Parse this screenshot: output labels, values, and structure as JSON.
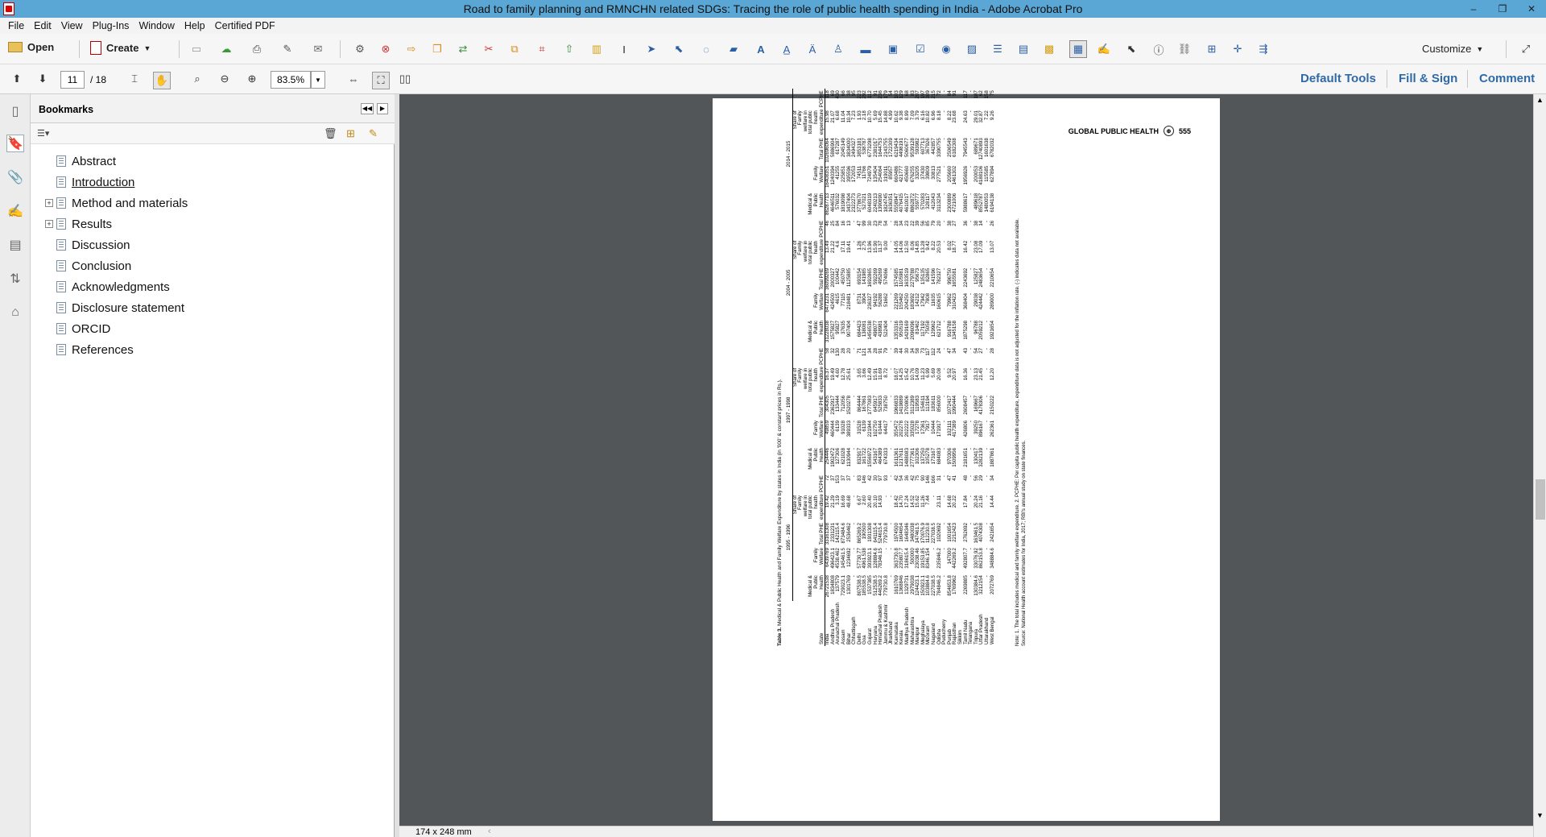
{
  "window": {
    "title": "Road to family planning and RMNCHN related SDGs: Tracing the role of public health spending in India - Adobe Acrobat Pro",
    "minimize": "–",
    "restore": "❐",
    "close": "✕"
  },
  "menu": [
    "File",
    "Edit",
    "View",
    "Plug-Ins",
    "Window",
    "Help",
    "Certified PDF"
  ],
  "toolbar": {
    "open_label": "Open",
    "create_label": "Create",
    "customize_label": "Customize"
  },
  "nav": {
    "current_page": "11",
    "total_pages": "/ 18",
    "zoom": "83.5%"
  },
  "right_panel_links": {
    "default_tools": "Default Tools",
    "fill_sign": "Fill & Sign",
    "comment": "Comment"
  },
  "bookmarks": {
    "title": "Bookmarks",
    "items": [
      {
        "label": "Abstract",
        "expandable": false
      },
      {
        "label": "Introduction",
        "expandable": false
      },
      {
        "label": "Method and materials",
        "expandable": true
      },
      {
        "label": "Results",
        "expandable": true
      },
      {
        "label": "Discussion",
        "expandable": false
      },
      {
        "label": "Conclusion",
        "expandable": false
      },
      {
        "label": "Acknowledgments",
        "expandable": false
      },
      {
        "label": "Disclosure statement",
        "expandable": false
      },
      {
        "label": "ORCID",
        "expandable": false
      },
      {
        "label": "References",
        "expandable": false
      }
    ]
  },
  "status": {
    "page_size": "174 x 248 mm"
  },
  "document": {
    "journal": "GLOBAL PUBLIC HEALTH",
    "page_number": "555",
    "table_caption_bold": "Table 3.",
    "table_caption": "Medical & Public Health and Family Welfare Expenditure by states in India (in '000' & constant prices in Rs.).",
    "periods": [
      "1995 - 1996",
      "1997 - 1998",
      "2004 - 2005",
      "2014 - 2015"
    ],
    "col_state": "State",
    "col_headers": [
      "Medical & Public Health",
      "Family Welfare",
      "Total PHE",
      "Share of Family welfare in total public health expenditure",
      "PCPHE"
    ],
    "rows": [
      [
        "India",
        "26721538",
        "6439769",
        "33161308",
        "19.42",
        "72",
        "254446",
        "49859",
        "304305",
        "16.37",
        "58",
        "31228038",
        "6471231",
        "36099269",
        "13.49",
        "46",
        "86287713",
        "16408351",
        "102696064",
        "15.98",
        "118"
      ],
      [
        "Andhra Pradesh",
        "1834808",
        "496423.1",
        "2331231",
        "21.29",
        "37",
        "1902472",
        "460444",
        "2362917",
        "19.49",
        "32",
        "1575827",
        "424500",
        "2000327",
        "21.22",
        "25",
        "4646511",
        "1240394",
        "5886904",
        "21.07",
        "69"
      ],
      [
        "Arunachal Pradesh",
        "137579",
        "4538.462",
        "142115.4",
        "3.19",
        "153",
        "127306",
        "6139",
        "133444",
        "4.60",
        "130",
        "95827",
        "4615",
        "100442",
        "4.6",
        "84",
        "576032",
        "41255",
        "617287",
        "6.68",
        "430"
      ],
      [
        "Assam",
        "729023.1",
        "145461.5",
        "873484.6",
        "16.69",
        "37",
        "621028",
        "91028",
        "712056",
        "12.78",
        "28",
        "37635",
        "77115",
        "450750",
        "17.11",
        "16",
        "1819098",
        "225851",
        "2045149",
        "11.04",
        "66"
      ],
      [
        "Bihar",
        "1301769",
        "1234692",
        "2536462",
        "48.68",
        "37",
        "1130944",
        "389333",
        "1520278",
        "25.61",
        "20",
        "907404",
        "218481",
        "1125885",
        "19.41",
        "13",
        "3437404",
        "395596",
        "3834000",
        "10.34",
        "38"
      ],
      [
        "Chhattisgarh",
        "-",
        "-",
        "-",
        "-",
        "-",
        "-",
        "-",
        "-",
        "-",
        "-",
        "-",
        "-",
        "-",
        "-",
        "-",
        "2322273",
        "172053",
        "2494327",
        "7.23",
        "95"
      ],
      [
        "Delhi",
        "807538.5",
        "57730.77",
        "865269.2",
        "6.67",
        "83",
        "832917",
        "31528",
        "864444",
        "3.65",
        "71",
        "684423",
        "8731",
        "693154",
        "1.26",
        "47",
        "3778670",
        "74511",
        "3853181",
        "1.93",
        "223"
      ],
      [
        "Goa",
        "185538.5",
        "4961.538",
        "190500",
        "2.60",
        "146",
        "161722",
        "6139",
        "167861",
        "3.66",
        "121",
        "138081",
        "3904",
        "141985",
        "2.75",
        "99",
        "527021",
        "11766",
        "538787",
        "2.18",
        "292"
      ],
      [
        "Gujarat",
        "1537385",
        "393923.1",
        "1931308",
        "20.40",
        "42",
        "1556972",
        "221944",
        "1777083",
        "12.49",
        "34",
        "1456538",
        "236327",
        "1692865",
        "13.96",
        "30",
        "6048319",
        "724979",
        "6773298",
        "10.70",
        "112"
      ],
      [
        "Haryana",
        "512538.5",
        "128884.6",
        "641115.4",
        "20.10",
        "30",
        "543167",
        "102750",
        "645917",
        "15.91",
        "28",
        "498077",
        "94192",
        "592269",
        "15.90",
        "23",
        "2240213",
        "135404",
        "2381017",
        "5.69",
        "91"
      ],
      [
        "Himachal Pradesh",
        "446269.2",
        "78346.15",
        "524615.4",
        "14.93",
        "97",
        "464389",
        "61444",
        "525833",
        "11.69",
        "91",
        "438981",
        "56288",
        "495269",
        "11.37",
        "78",
        "1390690",
        "254064",
        "1644753",
        "15.45",
        "236"
      ],
      [
        "Jammu & Kashmir",
        "779730.8",
        "-",
        "779730.8",
        "-",
        "93",
        "674333",
        "64417",
        "738750",
        "8.72",
        "79",
        "522404",
        "51662",
        "574066",
        "9.00",
        "54",
        "1824745",
        "319011",
        "2143755",
        "14.88",
        "179"
      ],
      [
        "Jharkhand",
        "-",
        "-",
        "-",
        "-",
        "-",
        "-",
        "-",
        "-",
        "-",
        "-",
        "-",
        "-",
        "-",
        "-",
        "-",
        "1636351",
        "85957",
        "1722309",
        "4.99",
        "54"
      ],
      [
        "Karnataka",
        "1610769",
        "363730.8",
        "1974500",
        "18.42",
        "42",
        "1611361",
        "355472",
        "1966833",
        "18.07",
        "39",
        "1353316",
        "221269",
        "1574585",
        "14.05",
        "28",
        "5558947",
        "660486",
        "6219434",
        "10.62",
        "103"
      ],
      [
        "Kerala",
        "1368846",
        "235807.7",
        "1604654",
        "14.70",
        "54",
        "1217611",
        "202278",
        "1419889",
        "14.25",
        "44",
        "950519",
        "155462",
        "1105981",
        "14.06",
        "34",
        "4076415",
        "421777",
        "4498191",
        "9.38",
        "129"
      ],
      [
        "Madhya Pradesh",
        "1329731",
        "318615.4",
        "1648346",
        "17.24",
        "36",
        "1488083",
        "202222",
        "1700806",
        "15.42",
        "30",
        "1429169",
        "204250",
        "1633519",
        "12.50",
        "23",
        "4610017",
        "450660",
        "5060677",
        "8.99",
        "68"
      ],
      [
        "Maharashtra",
        "2979038",
        "500000",
        "3480038",
        "14.52",
        "42",
        "2777361",
        "335028",
        "3112389",
        "10.76",
        "34",
        "2096096",
        "183692",
        "2279788",
        "8.06",
        "22",
        "8862872",
        "676255",
        "9539128",
        "7.09",
        "83"
      ],
      [
        "Manipur",
        "124423.1",
        "23038.46",
        "147461.5",
        "15.62",
        "75",
        "102306",
        "17278",
        "119583",
        "14.09",
        "58",
        "81462",
        "14212",
        "95673",
        "14.85",
        "39",
        "559777",
        "33205",
        "593982",
        "3.79",
        "207"
      ],
      [
        "Meghalaya",
        "150923.1",
        "19153.85",
        "170076.9",
        "11.26",
        "90",
        "137250",
        "17361",
        "154611",
        "11.23",
        "73",
        "117192",
        "17942",
        "135135",
        "13.28",
        "56",
        "570283",
        "37430",
        "607713",
        "6.16",
        "197"
      ],
      [
        "Mizoram",
        "103884.6",
        "8346.154",
        "112230.8",
        "7.44",
        "146",
        "105278",
        "7917",
        "113194",
        "6.99",
        "117",
        "75058",
        "7808",
        "82865",
        "9.42",
        "85",
        "328117",
        "39809",
        "367926",
        "10.82",
        "309"
      ],
      [
        "Nagaland",
        "227038.5",
        "-",
        "227038.5",
        "-",
        "166",
        "173167",
        "10444",
        "183611",
        "5.69",
        "112",
        "129962",
        "11635",
        "141596",
        "8.22",
        "79",
        "412043",
        "30813",
        "442857",
        "6.96",
        "215"
      ],
      [
        "Odisha",
        "784846.2",
        "235846.2",
        "1020692",
        "23.11",
        "31",
        "684083",
        "171917",
        "856000",
        "20.08",
        "24",
        "621712",
        "160615",
        "782327",
        "20.53",
        "20",
        "3113234",
        "277521",
        "3390755",
        "8.18",
        "72"
      ],
      [
        "Puducherry",
        "-",
        "-",
        "-",
        "-",
        "-",
        "-",
        "-",
        "-",
        "-",
        "-",
        "-",
        "-",
        "-",
        "-",
        "-",
        "-",
        "-",
        "-",
        "-",
        "-"
      ],
      [
        "Punjab",
        "854653.8",
        "147000",
        "1001654",
        "14.68",
        "47",
        "970306",
        "102111",
        "1072417",
        "9.52",
        "47",
        "916788",
        "79962",
        "996750",
        "8.02",
        "38",
        "2300889",
        "205660",
        "2506549",
        "8.22",
        "84"
      ],
      [
        "Rajasthan",
        "1769962",
        "442269.2",
        "2212423",
        "20.22",
        "41",
        "1509956",
        "417389",
        "1990444",
        "20.97",
        "34",
        "1345158",
        "310423",
        "1655581",
        "18.77",
        "27",
        "4721006",
        "1461302",
        "6182308",
        "23.68",
        "91"
      ],
      [
        "Sikkim",
        "",
        "",
        "",
        "",
        "",
        "",
        "",
        "",
        "",
        "",
        "",
        "",
        "",
        "",
        "",
        "",
        "",
        "",
        "",
        ""
      ],
      [
        "Tamil Nadu",
        "2269885",
        "492807.7",
        "2762692",
        "17.84",
        "48",
        "2181651",
        "426806",
        "2608457",
        "16.36",
        "43",
        "1875298",
        "368404",
        "2243692",
        "16.42",
        "36",
        "5988617",
        "1956926",
        "7945543",
        "24.63",
        "117"
      ],
      [
        "Telangana",
        "-",
        "-",
        "-",
        "-",
        "-",
        "-",
        "-",
        "-",
        "-",
        "-",
        "-",
        "-",
        "-",
        "-",
        "-",
        "-",
        "-",
        "-",
        "-",
        "-"
      ],
      [
        "Tripura",
        "130384.6",
        "33076.92",
        "163461.5",
        "20.24",
        "56",
        "130417",
        "39250",
        "169667",
        "23.13",
        "54",
        "96788",
        "29038",
        "125827",
        "23.08",
        "38",
        "489618",
        "200053",
        "689671",
        "29.01",
        "187"
      ],
      [
        "Uttar Pradesh",
        "3212154",
        "862153.8",
        "4074308",
        "21.16",
        "29",
        "3282139",
        "896167",
        "4178306",
        "21.45",
        "27",
        "2059212",
        "424442",
        "2483654",
        "17.09",
        "14",
        "8552787",
        "4188106",
        "12740893",
        "32.87",
        "62"
      ],
      [
        "Uttarakhand",
        "-",
        "-",
        "-",
        "-",
        "-",
        "-",
        "-",
        "-",
        "-",
        "-",
        "-",
        "-",
        "-",
        "-",
        "-",
        "1480053",
        "115585",
        "1601638",
        "7.22",
        "158"
      ],
      [
        "West Bengal",
        "2072769",
        "348884.6",
        "2421654",
        "14.44",
        "34",
        "1887861",
        "262361",
        "2150222",
        "12.20",
        "28",
        "1921654",
        "289000",
        "2210654",
        "13.07",
        "26",
        "6194138",
        "627894",
        "6782032",
        "9.26",
        "75"
      ]
    ],
    "note1": "Note: 1. The total includes medical and family welfare expenditure. 2. PCPHE: Per capita public health expenditure, expenditure data is not adjusted for the inflation rate. (-) indicates data not available.",
    "note2": "Source: National Health account estimates for India, 2017; RBI's annual study on state finances."
  }
}
